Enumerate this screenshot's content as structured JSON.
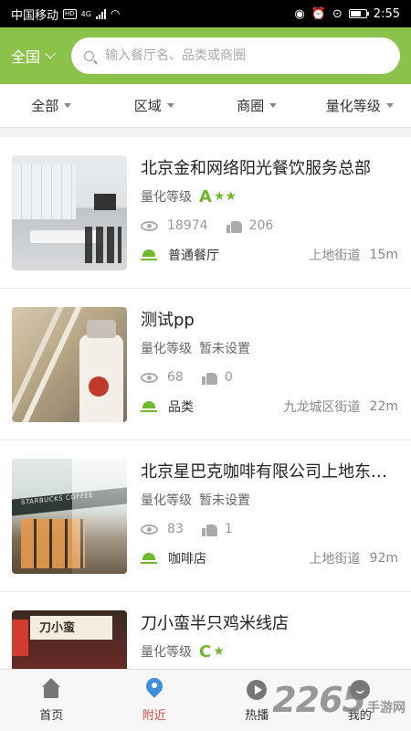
{
  "status_bar": {
    "carrier": "中国移动",
    "hd": "HD",
    "network": "4G",
    "time": "2:55"
  },
  "header": {
    "city": "全国",
    "search_placeholder": "输入餐厅名、品类或商圈"
  },
  "filters": [
    "全部",
    "区域",
    "商圈",
    "量化等级"
  ],
  "grade_label": "量化等级",
  "restaurants": [
    {
      "name": "北京金和网络阳光餐饮服务总部",
      "grade": "A",
      "stars": "★★",
      "grade_text": "",
      "views": "18974",
      "likes": "206",
      "category": "普通餐厅",
      "area": "上地街道",
      "distance": "15m"
    },
    {
      "name": "测试pp",
      "grade": "",
      "stars": "",
      "grade_text": "暂未设置",
      "views": "68",
      "likes": "0",
      "category": "品类",
      "area": "九龙城区街道",
      "distance": "22m"
    },
    {
      "name": "北京星巴克咖啡有限公司上地东…",
      "grade": "",
      "stars": "",
      "grade_text": "暂未设置",
      "views": "83",
      "likes": "1",
      "category": "咖啡店",
      "area": "上地街道",
      "distance": "92m"
    },
    {
      "name": "刀小蛮半只鸡米线店",
      "grade": "C",
      "stars": "★",
      "grade_text": "",
      "views": "",
      "likes": "",
      "category": "",
      "area": "",
      "distance": ""
    }
  ],
  "thumb_text": {
    "cafe_sign": "STARBUCKS COFFEE",
    "shop_sign": "刀小蛮"
  },
  "bottom_nav": [
    {
      "label": "首页",
      "icon": "home-icon"
    },
    {
      "label": "附近",
      "icon": "location-pin-icon"
    },
    {
      "label": "热播",
      "icon": "play-icon"
    },
    {
      "label": "我的",
      "icon": "user-icon"
    }
  ],
  "watermark": {
    "big": "2265",
    "small": "手游网"
  },
  "colors": {
    "brand_green": "#8bc34a",
    "grade_green": "#6fba2c",
    "active_nav": "#e24b3b",
    "pin_blue": "#3d8fe0"
  }
}
